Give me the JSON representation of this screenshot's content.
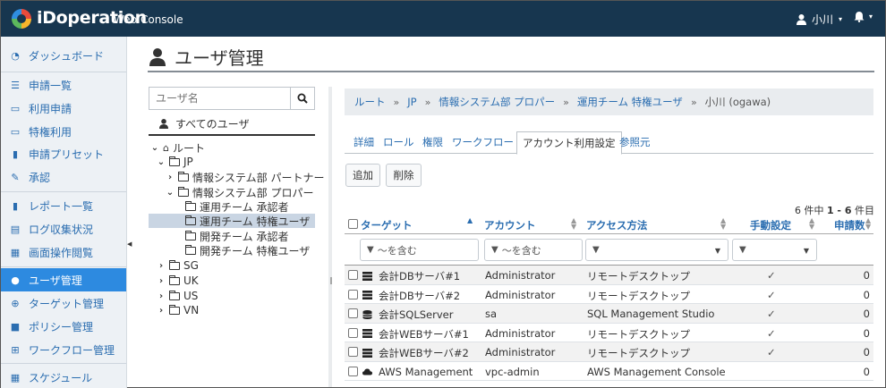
{
  "header": {
    "brand": "iDoperation",
    "brand_sub": "Web Console",
    "user_name": "小川",
    "user_caret": "▾",
    "bell_caret": "▾"
  },
  "sidebar": {
    "items": [
      {
        "label": "ダッシュボード",
        "icon": "dashboard-icon"
      },
      {
        "label": "申請一覧",
        "icon": "list-icon"
      },
      {
        "label": "利用申請",
        "icon": "inbox-icon"
      },
      {
        "label": "特権利用",
        "icon": "laptop-icon"
      },
      {
        "label": "申請プリセット",
        "icon": "bookmark-icon"
      },
      {
        "label": "承認",
        "icon": "edit-icon"
      },
      {
        "label": "レポート一覧",
        "icon": "file-icon"
      },
      {
        "label": "ログ収集状況",
        "icon": "database-icon"
      },
      {
        "label": "画面操作閲覧",
        "icon": "film-icon"
      },
      {
        "label": "ユーザ管理",
        "icon": "user-icon"
      },
      {
        "label": "ターゲット管理",
        "icon": "crosshair-icon"
      },
      {
        "label": "ポリシー管理",
        "icon": "lock-icon"
      },
      {
        "label": "ワークフロー管理",
        "icon": "sitemap-icon"
      },
      {
        "label": "スケジュール",
        "icon": "calendar-icon"
      }
    ],
    "active_index": 9
  },
  "page": {
    "title": "ユーザ管理"
  },
  "tree": {
    "search_placeholder": "ユーザ名",
    "all_users": "すべてのユーザ",
    "nodes": [
      {
        "label": "ルート",
        "type": "home",
        "chevron": "down",
        "depth": 0
      },
      {
        "label": "JP",
        "type": "folder",
        "chevron": "down",
        "depth": 1
      },
      {
        "label": "情報システム部 パートナー",
        "type": "folder",
        "chevron": "right",
        "depth": 2
      },
      {
        "label": "情報システム部 プロパー",
        "type": "folder",
        "chevron": "down",
        "depth": 2
      },
      {
        "label": "運用チーム 承認者",
        "type": "folder",
        "chevron": "none",
        "depth": 3
      },
      {
        "label": "運用チーム 特権ユーザ",
        "type": "folder",
        "chevron": "none",
        "depth": 3,
        "selected": true
      },
      {
        "label": "開発チーム 承認者",
        "type": "folder",
        "chevron": "none",
        "depth": 3
      },
      {
        "label": "開発チーム 特権ユーザ",
        "type": "folder",
        "chevron": "none",
        "depth": 3
      },
      {
        "label": "SG",
        "type": "folder",
        "chevron": "right",
        "depth": 1
      },
      {
        "label": "UK",
        "type": "folder",
        "chevron": "right",
        "depth": 1
      },
      {
        "label": "US",
        "type": "folder",
        "chevron": "right",
        "depth": 1
      },
      {
        "label": "VN",
        "type": "folder",
        "chevron": "right",
        "depth": 1
      }
    ]
  },
  "breadcrumb": {
    "links": [
      "ルート",
      "JP",
      "情報システム部 プロパー",
      "運用チーム 特権ユーザ"
    ],
    "current": "小川 (ogawa)",
    "separator": "»"
  },
  "tabs": [
    {
      "label": "詳細"
    },
    {
      "label": "ロール"
    },
    {
      "label": "権限"
    },
    {
      "label": "ワークフロー"
    },
    {
      "label": "アカウント利用設定",
      "active": true
    },
    {
      "label": "参照元"
    }
  ],
  "actions": {
    "add_label": "追加",
    "delete_label": "削除"
  },
  "count": {
    "prefix": "6 件中 ",
    "range": "1 - 6",
    "suffix": " 件目"
  },
  "table": {
    "headers": [
      "ターゲット",
      "アカウント",
      "アクセス方法",
      "手動設定",
      "申請数"
    ],
    "filters": {
      "target_placeholder": "〜を含む",
      "account_placeholder": "〜を含む"
    },
    "rows": [
      {
        "target": "会計DBサーバ#1",
        "icon": "server-icon",
        "account": "Administrator",
        "access": "リモートデスクトップ",
        "manual": "✓",
        "count": "0"
      },
      {
        "target": "会計DBサーバ#2",
        "icon": "server-icon",
        "account": "Administrator",
        "access": "リモートデスクトップ",
        "manual": "✓",
        "count": "0"
      },
      {
        "target": "会計SQLServer",
        "icon": "database-icon",
        "account": "sa",
        "access": "SQL Management Studio",
        "manual": "✓",
        "count": "0"
      },
      {
        "target": "会計WEBサーバ#1",
        "icon": "server-icon",
        "account": "Administrator",
        "access": "リモートデスクトップ",
        "manual": "✓",
        "count": "0"
      },
      {
        "target": "会計WEBサーバ#2",
        "icon": "server-icon",
        "account": "Administrator",
        "access": "リモートデスクトップ",
        "manual": "✓",
        "count": "0"
      },
      {
        "target": "AWS Management",
        "icon": "cloud-icon",
        "account": "vpc-admin",
        "access": "AWS Management Console",
        "manual": "",
        "count": "0"
      }
    ]
  },
  "colors": {
    "header_bg": "#17364f",
    "accent": "#2d8ae0",
    "link": "#2a6db0"
  }
}
